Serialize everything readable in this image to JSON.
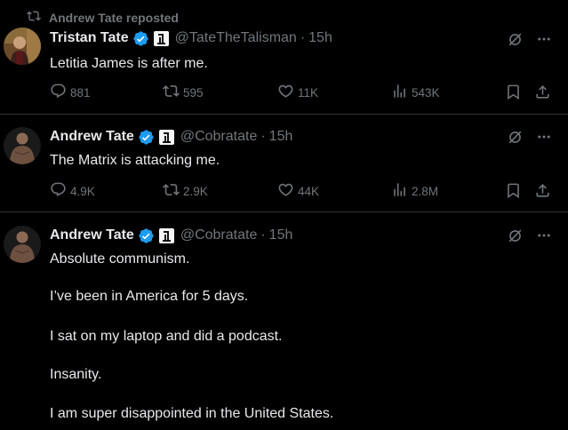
{
  "colors": {
    "background": "#000000",
    "text_primary": "#e7e9ea",
    "text_secondary": "#71767b",
    "verified_blue": "#1d9bf0",
    "divider": "#2f3336"
  },
  "tweets": [
    {
      "repost_label": "Andrew Tate reposted",
      "name": "Tristan Tate",
      "handle": "@TateTheTalisman",
      "separator": "·",
      "time": "15h",
      "text": "Letitia James is after me.",
      "replies": "881",
      "reposts": "595",
      "likes": "11K",
      "views": "543K",
      "icons": [
        "repost-icon",
        "verified-badge-icon",
        "affiliate-badge-icon",
        "grok-icon",
        "more-icon",
        "reply-icon",
        "retweet-icon",
        "like-icon",
        "views-icon",
        "bookmark-icon",
        "share-icon"
      ]
    },
    {
      "name": "Andrew Tate",
      "handle": "@Cobratate",
      "separator": "·",
      "time": "15h",
      "text": "The Matrix is attacking me.",
      "replies": "4.9K",
      "reposts": "2.9K",
      "likes": "44K",
      "views": "2.8M"
    },
    {
      "name": "Andrew Tate",
      "handle": "@Cobratate",
      "separator": "·",
      "time": "15h",
      "lines": [
        "Absolute communism.",
        "I’ve been in America for 5 days.",
        "I sat on my laptop and did a podcast.",
        "Insanity.",
        "I am super disappointed in the United States."
      ]
    }
  ]
}
